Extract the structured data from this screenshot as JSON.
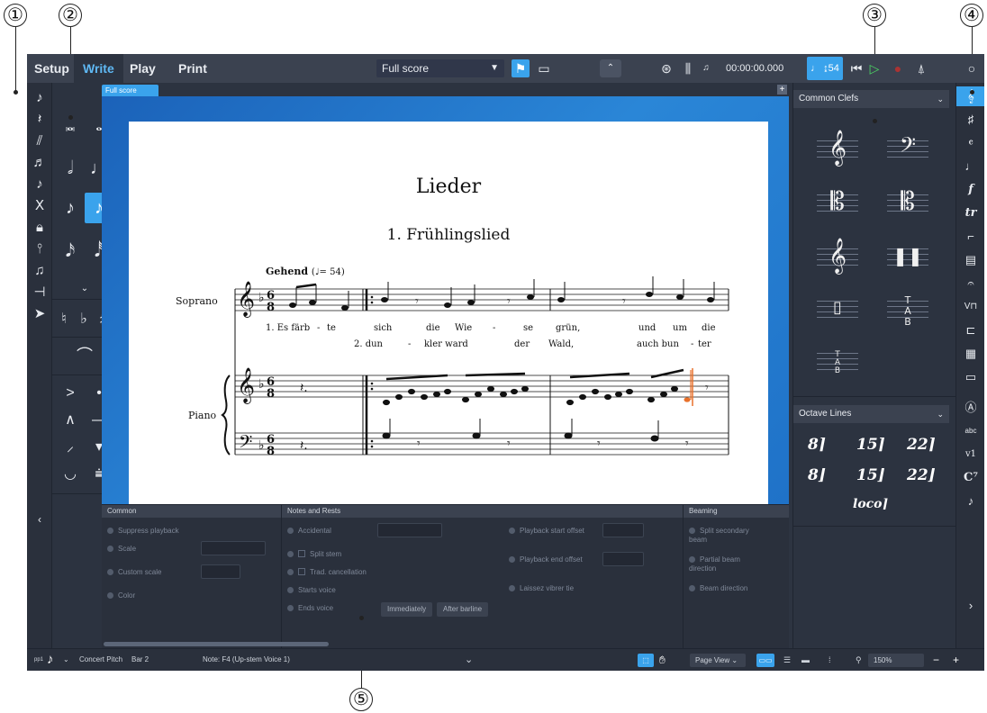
{
  "callouts": [
    "①",
    "②",
    "③",
    "④",
    "⑤"
  ],
  "toolbar": {
    "modes": [
      "Setup",
      "Write",
      "Play",
      "Print"
    ],
    "active_mode": "Write",
    "layout_select": "Full score",
    "timecode": "00:00:00.000",
    "tempo": "54"
  },
  "tabs": {
    "full_score": "Full score"
  },
  "score": {
    "title": "Lieder",
    "subtitle": "1. Frühlingslied",
    "tempo_marking": "Gehend",
    "tempo_value": "= 54)",
    "instruments": [
      "Soprano",
      "Piano"
    ],
    "lyrics_line1": [
      "1. Es färb",
      "-",
      "te",
      "sich",
      "die",
      "Wie",
      "-",
      "se",
      "grün,",
      "und",
      "um",
      "die"
    ],
    "lyrics_line2": [
      "2. dun",
      "-",
      "kler ward",
      "der",
      "Wald,",
      "auch bun",
      "-",
      "ter"
    ]
  },
  "properties": {
    "groups": [
      "Common",
      "Notes and Rests",
      "Beaming"
    ],
    "common": [
      "Suppress playback",
      "Scale",
      "Custom scale",
      "Color"
    ],
    "notes_rests": [
      "Accidental",
      "Split stem",
      "Trad. cancellation",
      "Starts voice",
      "Ends voice"
    ],
    "notes_rests_right": [
      "Playback start offset",
      "Playback end offset",
      "Laissez vibrer tie"
    ],
    "buttons": [
      "Immediately",
      "After barline"
    ],
    "beaming": [
      "Split secondary beam",
      "Partial beam direction",
      "Beam direction"
    ]
  },
  "right_panel": {
    "clefs_title": "Common Clefs",
    "octave_title": "Octave Lines",
    "octave_items": [
      "8",
      "15",
      "22",
      "8",
      "15",
      "22",
      "loco"
    ]
  },
  "panel_strip": [
    "abc",
    "v1"
  ],
  "statusbar": {
    "concert_pitch": "Concert Pitch",
    "bar": "Bar 2",
    "note": "Note: F4 (Up-stem Voice 1)",
    "view": "Page View",
    "zoom": "150%"
  }
}
